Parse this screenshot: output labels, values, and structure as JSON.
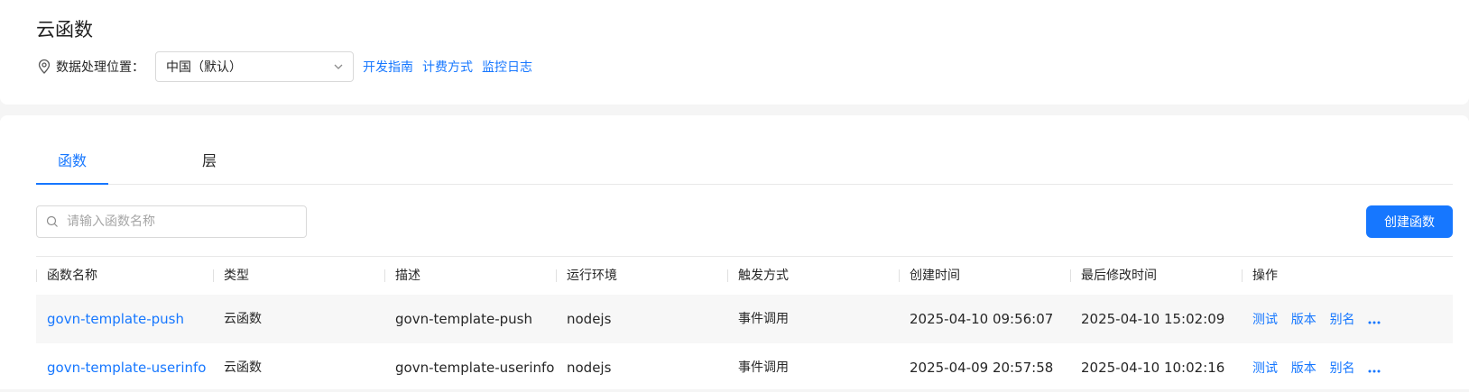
{
  "header": {
    "title": "云函数",
    "region_label": "数据处理位置：",
    "region_value": "中国（默认）",
    "links": [
      "开发指南",
      "计费方式",
      "监控日志"
    ]
  },
  "tabs": [
    {
      "label": "函数",
      "active": true
    },
    {
      "label": "层",
      "active": false
    }
  ],
  "search": {
    "placeholder": "请输入函数名称",
    "value": ""
  },
  "create_button": "创建函数",
  "table": {
    "columns": [
      "函数名称",
      "类型",
      "描述",
      "运行环境",
      "触发方式",
      "创建时间",
      "最后修改时间",
      "操作"
    ],
    "rows": [
      {
        "name": "govn-template-push",
        "type": "云函数",
        "description": "govn-template-push",
        "runtime": "nodejs",
        "trigger": "事件调用",
        "created": "2025-04-10 09:56:07",
        "modified": "2025-04-10 15:02:09",
        "actions": [
          "测试",
          "版本",
          "别名"
        ]
      },
      {
        "name": "govn-template-userinfo",
        "type": "云函数",
        "description": "govn-template-userinfo",
        "runtime": "nodejs",
        "trigger": "事件调用",
        "created": "2025-04-09 20:57:58",
        "modified": "2025-04-10 10:02:16",
        "actions": [
          "测试",
          "版本",
          "别名"
        ]
      }
    ]
  },
  "colors": {
    "accent": "#1677ff",
    "text": "#262626",
    "row_alt_bg": "#f7f7f7"
  },
  "icons": [
    "location-pin-icon",
    "chevron-down-icon",
    "search-icon",
    "more-icon"
  ]
}
